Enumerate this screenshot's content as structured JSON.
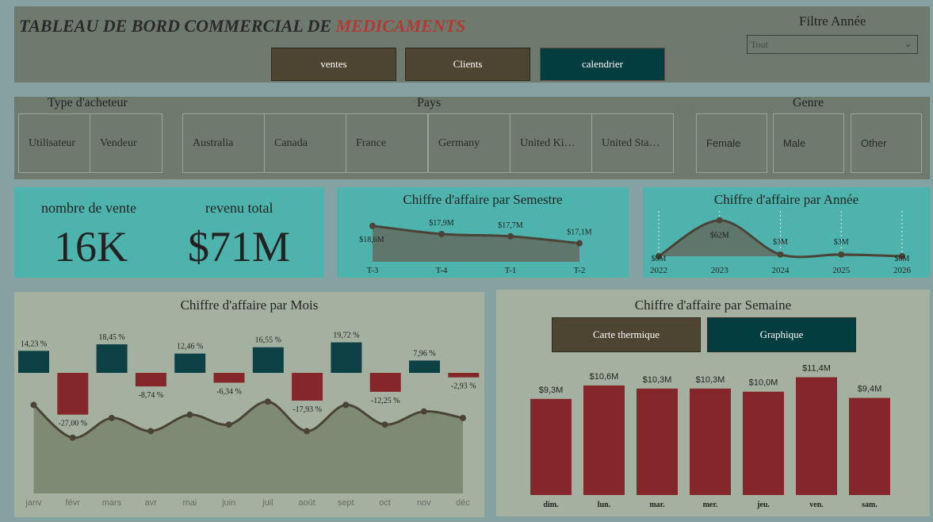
{
  "header": {
    "title_main": "TABLEAU DE BORD COMMERCIAL DE ",
    "title_accent": "MEDICAMENTS",
    "nav": [
      {
        "label": "ventes",
        "color": "#4d4532"
      },
      {
        "label": "Clients",
        "color": "#4d4532"
      },
      {
        "label": "calendrier",
        "color": "#043d3f"
      }
    ],
    "filter_year_label": "Filtre Année",
    "year_select_value": "Tout"
  },
  "filters": {
    "buyer_type": {
      "title": "Type d'acheteur",
      "options": [
        "Utilisateur",
        "Vendeur"
      ]
    },
    "country": {
      "title": "Pays",
      "options": [
        "Australia",
        "Canada",
        "France",
        "Germany",
        "United Ki…",
        "United Sta…"
      ]
    },
    "gender": {
      "title": "Genre",
      "options": [
        "Female",
        "Male",
        "Other"
      ]
    }
  },
  "kpis": {
    "sales_count_label": "nombre de vente",
    "sales_count_value": "16K",
    "revenue_label": "revenu total",
    "revenue_value": "$71M"
  },
  "toggles": {
    "heatmap_label": "Carte thermique",
    "chart_label": "Graphique",
    "heatmap_color": "#4d4532",
    "chart_color": "#043d3f"
  },
  "colors": {
    "teal_panel": "#4eb3ad",
    "positive_bar": "#0e4146",
    "negative_bar": "#85272a",
    "area_fill": "#5f766d",
    "line": "#4b4436",
    "month_area": "#7f8a74",
    "week_bar": "#85272a"
  },
  "chart_data": [
    {
      "id": "semestre",
      "type": "area",
      "title": "Chiffre d'affaire par Semestre",
      "categories": [
        "T-3",
        "T-4",
        "T-1",
        "T-2"
      ],
      "values": [
        18.6,
        17.9,
        17.7,
        17.1
      ],
      "labels": [
        "$18,6M",
        "$17,9M",
        "$17,7M",
        "$17,1M"
      ],
      "ylim": [
        15.5,
        19.2
      ]
    },
    {
      "id": "annee",
      "type": "area",
      "title": "Chiffre d'affaire par Année",
      "categories": [
        "2022",
        "2023",
        "2024",
        "2025",
        "2026"
      ],
      "values": [
        0,
        62,
        3,
        3,
        0
      ],
      "labels": [
        "$0M",
        "$62M",
        "$3M",
        "$3M",
        "$0M"
      ],
      "ylim": [
        0,
        85
      ]
    },
    {
      "id": "mois",
      "type": "bar",
      "title": "Chiffre d'affaire par Mois",
      "categories": [
        "janv",
        "févr",
        "mars",
        "avr",
        "mai",
        "juin",
        "juil",
        "août",
        "sept",
        "oct",
        "nov",
        "déc"
      ],
      "growth_pct": [
        14.23,
        -27.0,
        18.45,
        -8.74,
        12.46,
        -6.34,
        16.55,
        -17.93,
        19.72,
        -12.25,
        7.96,
        -2.93
      ],
      "growth_labels": [
        "14,23 %",
        "-27,00 %",
        "18,45 %",
        "-8,74 %",
        "12,46 %",
        "-6,34 %",
        "16,55 %",
        "-17,93 %",
        "19,72 %",
        "-12,25 %",
        "7,96 %",
        "-2,93 %"
      ],
      "revenue_trend": [
        6.7,
        5.7,
        6.3,
        5.9,
        6.4,
        6.1,
        6.8,
        5.9,
        6.7,
        6.1,
        6.5,
        6.3
      ],
      "trend_ylim": [
        4.0,
        7.0
      ]
    },
    {
      "id": "semaine",
      "type": "bar",
      "title": "Chiffre d'affaire par Semaine",
      "categories": [
        "dim.",
        "lun.",
        "mar.",
        "mer.",
        "jeu.",
        "ven.",
        "sam."
      ],
      "values": [
        9.3,
        10.6,
        10.3,
        10.3,
        10.0,
        11.4,
        9.4
      ],
      "labels": [
        "$9,3M",
        "$10,6M",
        "$10,3M",
        "$10,3M",
        "$10,0M",
        "$11,4M",
        "$9,4M"
      ],
      "ylim": [
        0,
        12
      ]
    }
  ]
}
